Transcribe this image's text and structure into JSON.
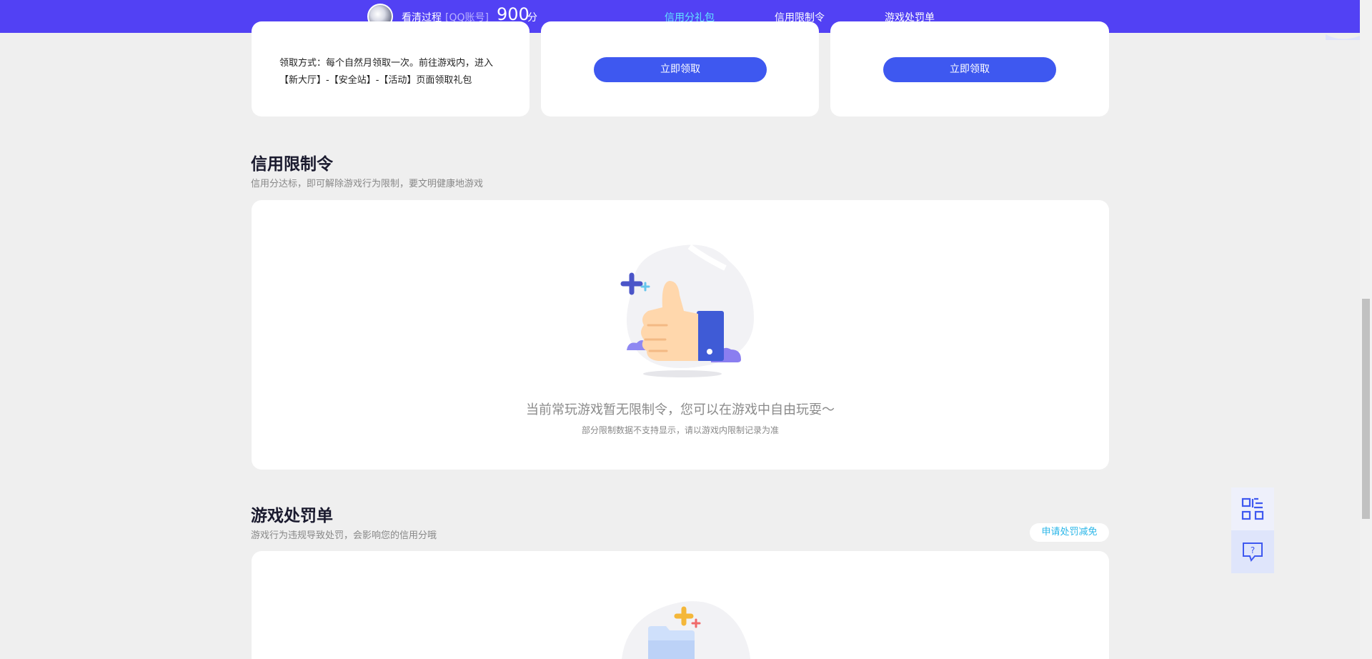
{
  "header": {
    "user_name": "看清过程",
    "account_type": "[QQ账号]",
    "score": "900",
    "score_unit": "分",
    "tabs": [
      {
        "label": "信用分礼包",
        "active": true
      },
      {
        "label": "信用限制令",
        "active": false
      },
      {
        "label": "游戏处罚单",
        "active": false
      }
    ]
  },
  "gift_cards": {
    "claim_method": "领取方式：每个自然月领取一次。前往游戏内，进入【新大厅】-【安全站】-【活动】页面领取礼包",
    "claim_button_label": "立即领取"
  },
  "restriction": {
    "title": "信用限制令",
    "subtitle": "信用分达标，即可解除游戏行为限制，要文明健康地游戏",
    "empty_title": "当前常玩游戏暂无限制令，您可以在游戏中自由玩耍～",
    "empty_note": "部分限制数据不支持显示，请以游戏内限制记录为准"
  },
  "penalty": {
    "title": "游戏处罚单",
    "subtitle": "游戏行为违规导致处罚，会影响您的信用分哦",
    "appeal_button": "申请处罚减免"
  },
  "side_float": {
    "qr_icon": "qr-code-icon",
    "help_icon": "help-chat-icon"
  },
  "colors": {
    "topbar": "#5241f4",
    "accent_tab": "#62e3ff",
    "primary_button": "#3e58f0",
    "page_bg": "#efefef"
  }
}
